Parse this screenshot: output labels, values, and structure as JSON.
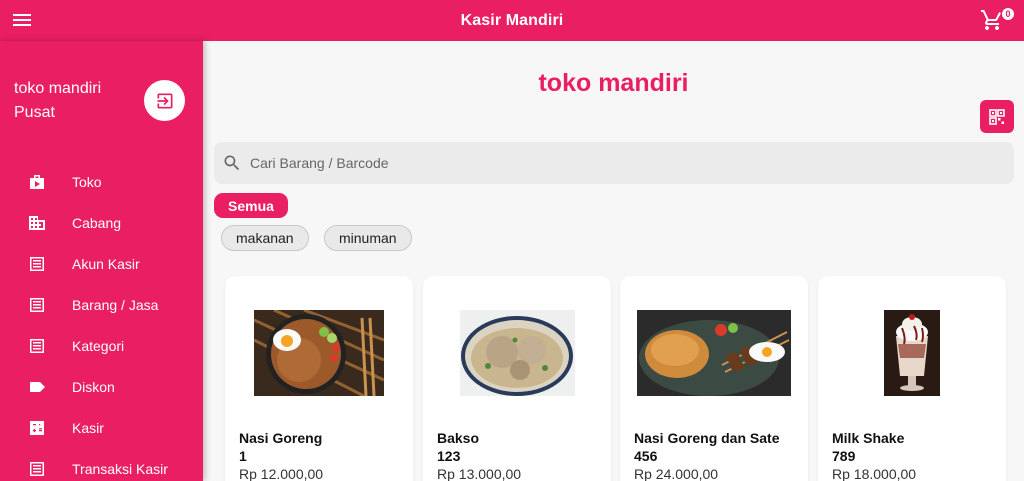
{
  "app": {
    "title": "Kasir Mandiri",
    "cart_count": "0"
  },
  "sidebar": {
    "store_name": "toko mandiri",
    "branch": "Pusat",
    "items": [
      {
        "label": "Toko",
        "icon": "store-icon"
      },
      {
        "label": "Cabang",
        "icon": "building-icon"
      },
      {
        "label": "Akun Kasir",
        "icon": "list-icon"
      },
      {
        "label": "Barang / Jasa",
        "icon": "list-icon"
      },
      {
        "label": "Kategori",
        "icon": "list-icon"
      },
      {
        "label": "Diskon",
        "icon": "label-icon"
      },
      {
        "label": "Kasir",
        "icon": "calculator-icon"
      },
      {
        "label": "Transaksi Kasir",
        "icon": "list-icon"
      }
    ]
  },
  "main": {
    "title": "toko mandiri",
    "search_placeholder": "Cari Barang / Barcode",
    "category_all": "Semua",
    "categories": [
      "makanan",
      "minuman"
    ],
    "products": [
      {
        "name": "Nasi Goreng",
        "code": "1",
        "price": "Rp 12.000,00"
      },
      {
        "name": "Bakso",
        "code": "123",
        "price": "Rp 13.000,00"
      },
      {
        "name": "Nasi Goreng dan Sate",
        "code": "456",
        "price": "Rp 24.000,00"
      },
      {
        "name": "Milk Shake",
        "code": "789",
        "price": "Rp 18.000,00"
      }
    ]
  },
  "colors": {
    "primary": "#e91e63",
    "background": "#f7f7f7",
    "card": "#ffffff"
  }
}
